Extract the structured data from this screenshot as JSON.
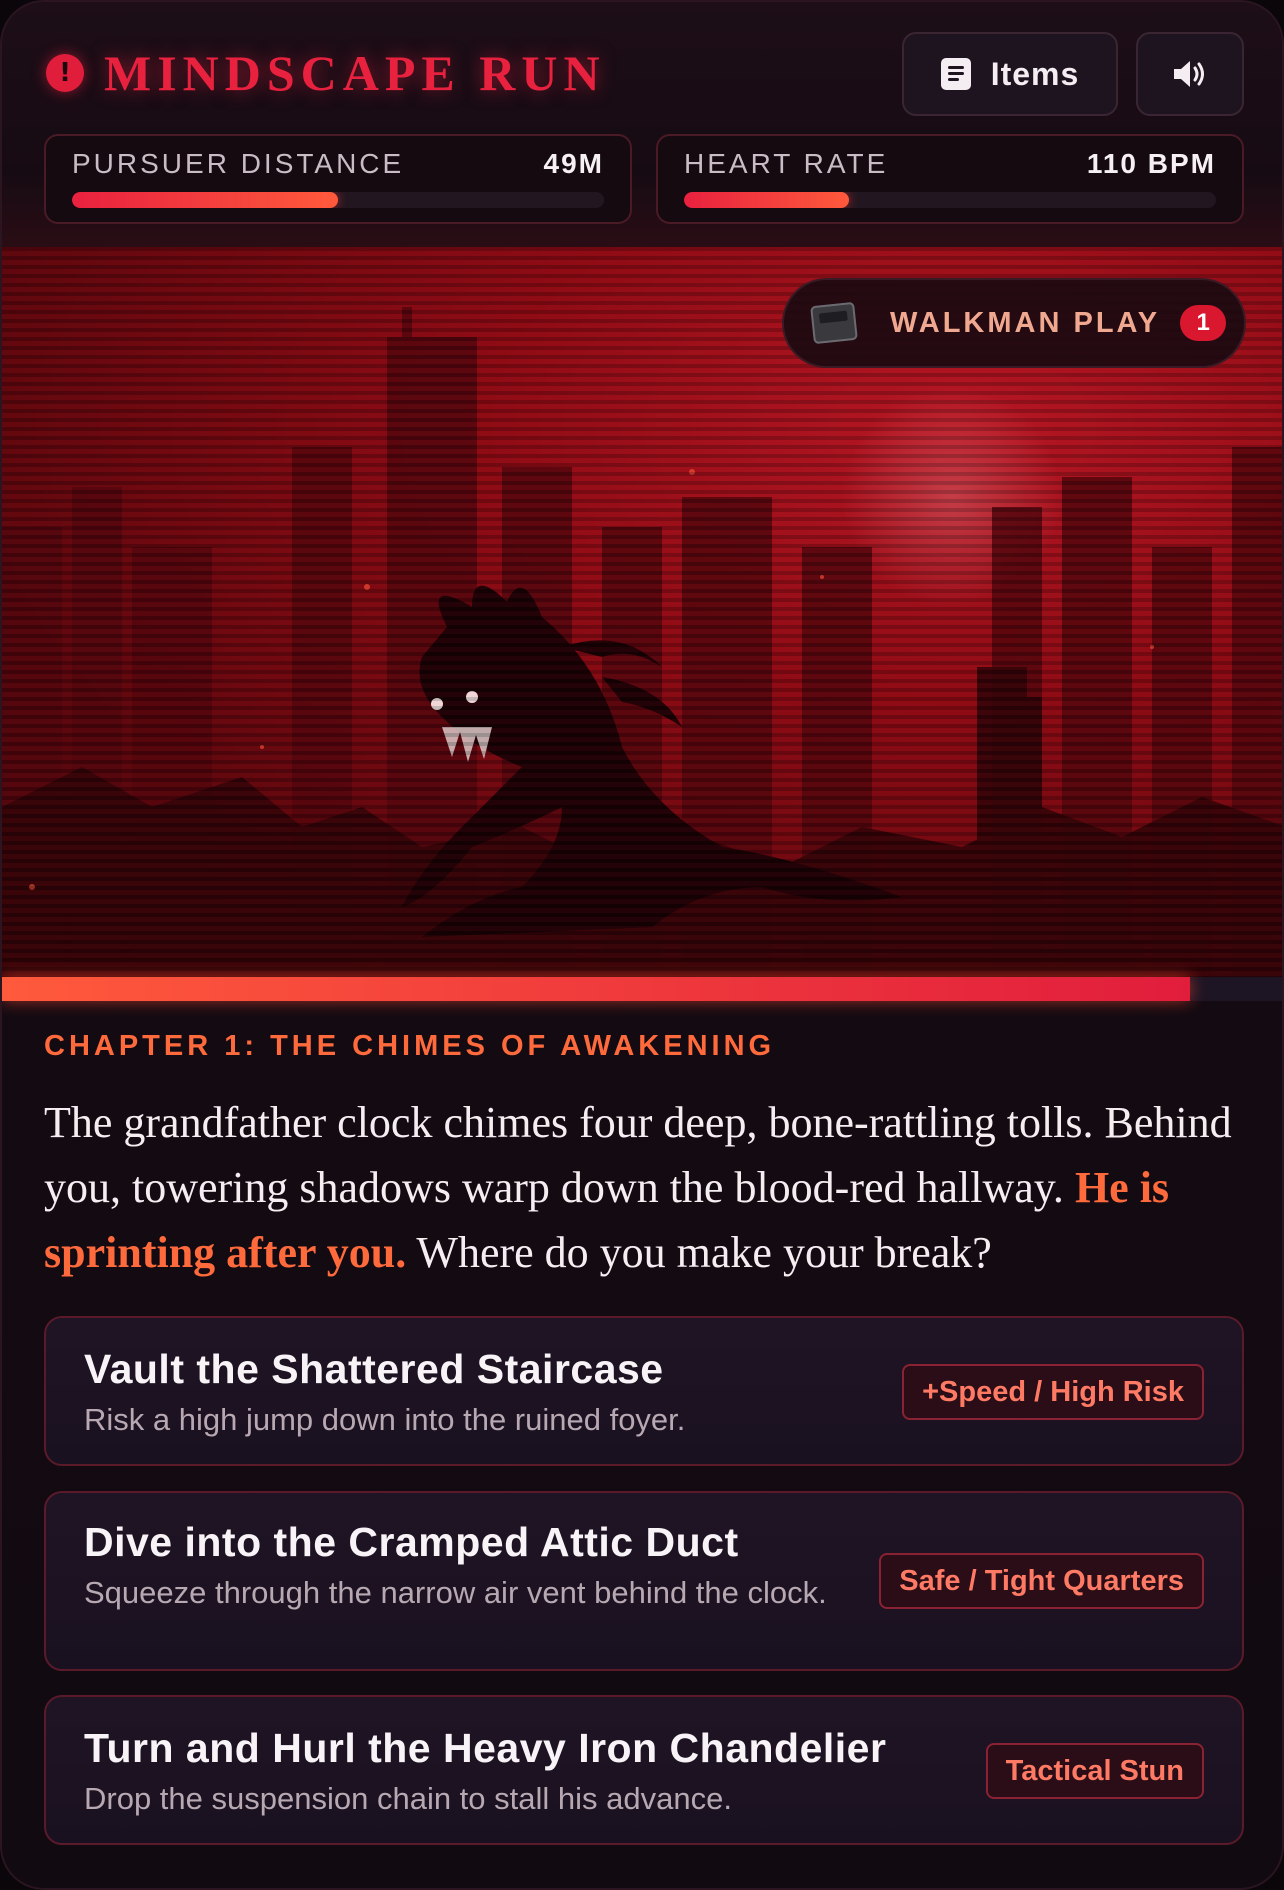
{
  "header": {
    "title": "MINDSCAPE RUN",
    "alert_icon": "alert-circle-icon",
    "items_button": {
      "label": "Items",
      "icon": "document-icon"
    },
    "sound_button": {
      "icon": "speaker-icon"
    }
  },
  "stats": {
    "pursuer": {
      "label": "PURSUER DISTANCE",
      "value": "49M",
      "fill_fraction": 0.5
    },
    "heart": {
      "label": "HEART RATE",
      "value": "110 BPM",
      "fill_fraction": 0.31
    }
  },
  "scene": {
    "walkman": {
      "label": "WALKMAN PLAY",
      "count": "1",
      "icon": "cassette-icon"
    },
    "progress_fraction": 0.928
  },
  "story": {
    "chapter": "CHAPTER 1: THE CHIMES OF AWAKENING",
    "text_before": "The grandfather clock chimes four deep, bone-rattling tolls. Behind you, towering shadows warp down the blood-red hallway. ",
    "highlight": "He is sprinting after you.",
    "text_after": " Where do you make your break?"
  },
  "choices": [
    {
      "title": "Vault the Shattered Staircase",
      "description": "Risk a high jump down into the ruined foyer.",
      "tag": "+Speed / High Risk"
    },
    {
      "title": "Dive into the Cramped Attic Duct",
      "description": "Squeeze through the narrow air vent behind the clock.",
      "tag": "Safe / Tight Quarters"
    },
    {
      "title": "Turn and Hurl the Heavy Iron Chandelier",
      "description": "Drop the suspension chain to stall his advance.",
      "tag": "Tactical Stun"
    }
  ],
  "colors": {
    "accent_red": "#e8213f",
    "accent_orange": "#ff6a3d",
    "background": "#140b12"
  }
}
